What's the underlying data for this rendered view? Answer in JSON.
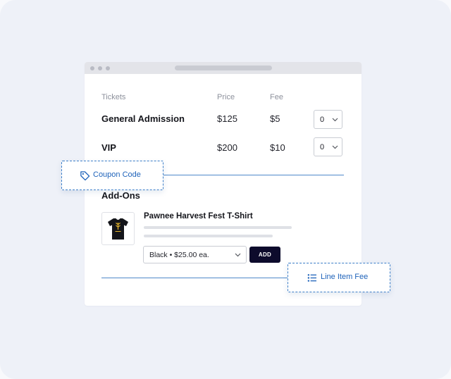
{
  "tickets": {
    "headers": {
      "name": "Tickets",
      "price": "Price",
      "fee": "Fee"
    },
    "rows": [
      {
        "name": "General Admission",
        "price": "$125",
        "fee": "$5",
        "qty": "0"
      },
      {
        "name": "VIP",
        "price": "$200",
        "fee": "$10",
        "qty": "0"
      }
    ]
  },
  "addons": {
    "title": "Add-Ons",
    "product": {
      "name": "Pawnee Harvest Fest T-Shirt",
      "variant": "Black • $25.00 ea.",
      "add_label": "ADD"
    }
  },
  "callouts": {
    "coupon": "Coupon Code",
    "line_item_fee": "Line Item Fee"
  },
  "icons": {
    "coupon": "tag-icon",
    "line_item_fee": "list-icon",
    "dropdown": "chevron-down-icon"
  },
  "colors": {
    "accent": "#1f63ba",
    "divider": "#4e88c9",
    "button": "#0d0b2c",
    "background": "#eef1f8"
  }
}
